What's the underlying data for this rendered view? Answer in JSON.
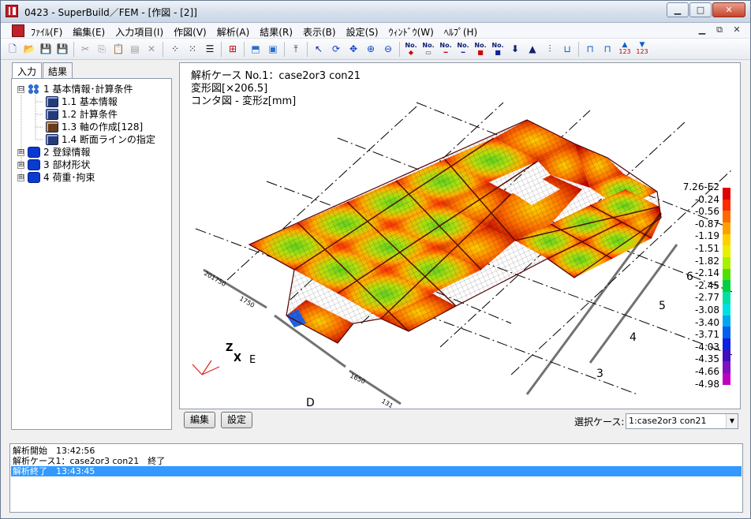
{
  "window": {
    "title": "0423 - SuperBuild／FEM - [作図 - [2]]",
    "controls": [
      "minimize",
      "maximize",
      "close"
    ]
  },
  "menu": {
    "items": [
      "ﾌｧｲﾙ(F)",
      "編集(E)",
      "入力項目(I)",
      "作図(V)",
      "解析(A)",
      "結果(R)",
      "表示(B)",
      "設定(S)",
      "ｳｨﾝﾄﾞｳ(W)",
      "ﾍﾙﾌﾟ(H)"
    ]
  },
  "toolbar": {
    "no_label": "No.",
    "num_labels": [
      "123",
      "123"
    ]
  },
  "tabs": [
    "入力",
    "結果"
  ],
  "tree": [
    {
      "label": "1 基本情報･計算条件",
      "expander": "⊟",
      "icon": "group-icon"
    },
    {
      "label": "1.1 基本情報",
      "icon": "document-icon"
    },
    {
      "label": "1.2 計算条件",
      "icon": "document-icon"
    },
    {
      "label": "1.3 軸の作成[128]",
      "icon": "axis-document-icon"
    },
    {
      "label": "1.4 断面ラインの指定",
      "icon": "document-icon"
    },
    {
      "label": "2 登録情報",
      "expander": "⊞",
      "icon": "blue-block-icon"
    },
    {
      "label": "3 部材形状",
      "expander": "⊞",
      "icon": "blue-block-icon"
    },
    {
      "label": "4 荷重･拘束",
      "expander": "⊞",
      "icon": "blue-block-icon"
    }
  ],
  "view": {
    "info": [
      "解析ケース No.1：case2or3 con21",
      "変形図[×206.5]",
      "コンタ図 - 変形z[mm]"
    ],
    "axis_labels": {
      "z": "Z",
      "x": "X",
      "e": "E"
    },
    "grid_labels": [
      "D",
      "3",
      "4",
      "5",
      "6"
    ],
    "legend": {
      "values": [
        "7.26-E2",
        "-0.24",
        "-0.56",
        "-0.87",
        "-1.19",
        "-1.51",
        "-1.82",
        "-2.14",
        "-2.45",
        "-2.77",
        "-3.08",
        "-3.40",
        "-3.71",
        "-4.03",
        "-4.35",
        "-4.66",
        "-4.98"
      ],
      "colors": [
        "#e00000",
        "#ff2a00",
        "#ff6a00",
        "#ffa000",
        "#ffd000",
        "#e8f000",
        "#a8f000",
        "#50e000",
        "#00d040",
        "#00e0a0",
        "#00e0e0",
        "#00a8f0",
        "#0060f0",
        "#1020e0",
        "#4010c0",
        "#8010c0",
        "#c000c0"
      ]
    },
    "member_label_fragments": [
      "201750",
      "1750",
      "1650",
      "131"
    ]
  },
  "bottom": {
    "edit_button": "編集",
    "settings_button": "設定",
    "case_label": "選択ケース:",
    "case_value": "1:case2or3 con21"
  },
  "log": {
    "lines": [
      "解析開始　13:42:56",
      "解析ケース1：case2or3 con21　終了",
      "解析終了　13:43:45"
    ]
  }
}
